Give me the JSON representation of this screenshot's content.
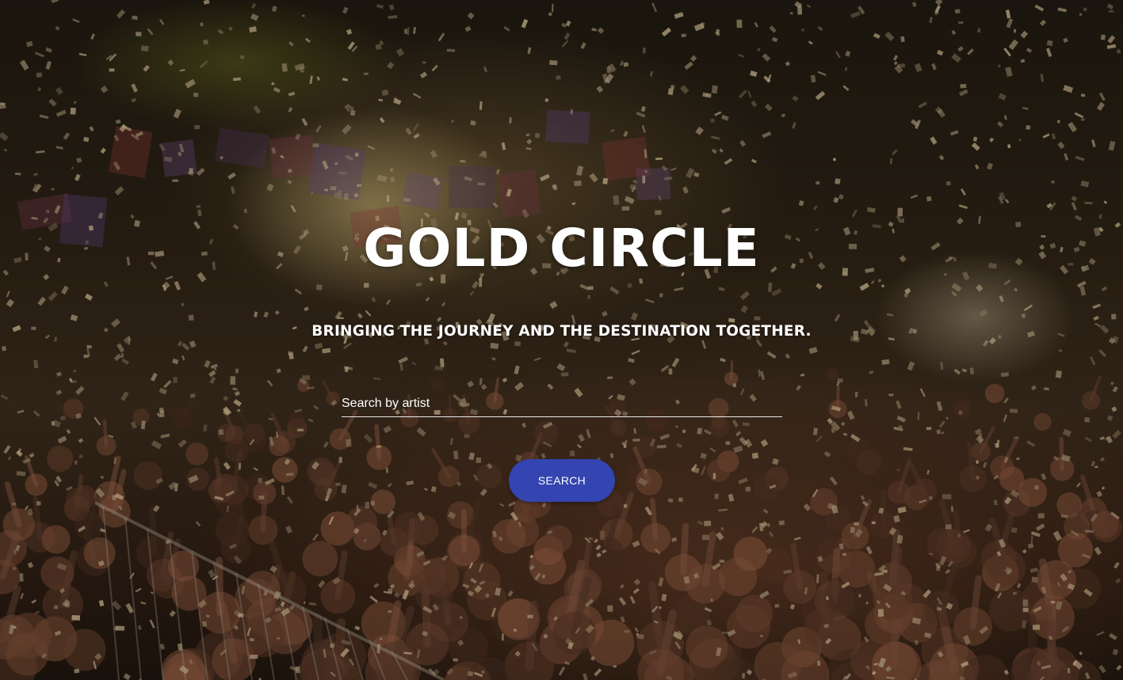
{
  "hero": {
    "title": "GOLD CIRCLE",
    "tagline": "BRINGING THE JOURNEY AND THE DESTINATION TOGETHER."
  },
  "search": {
    "placeholder": "Search by artist",
    "value": "",
    "button_label": "SEARCH",
    "button_color": "#3444b0"
  },
  "background": {
    "description_icon": "concert-crowd-confetti-photo"
  }
}
